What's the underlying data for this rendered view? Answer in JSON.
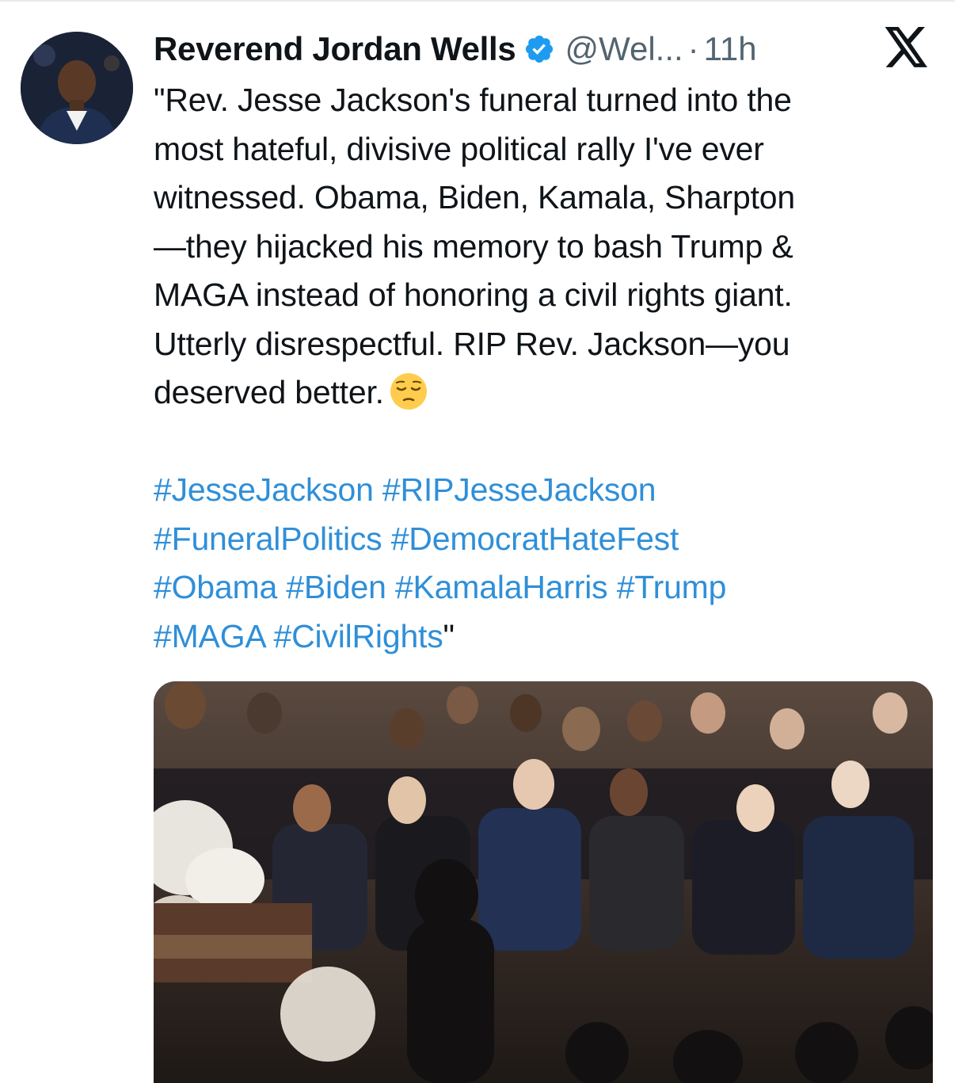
{
  "tweet": {
    "author": {
      "display_name": "Reverend Jordan Wells",
      "handle": "@Wel...",
      "separator": "·",
      "time": "11h",
      "verified": true,
      "verified_icon": "verified-badge-icon",
      "avatar_icon": "avatar"
    },
    "platform_icon": "x-logo-icon",
    "text_lines": [
      "\"Rev. Jesse Jackson's funeral turned into the",
      "most hateful, divisive political rally I've ever",
      "witnessed. Obama, Biden, Kamala, Sharpton",
      "—they hijacked his memory to bash Trump &",
      "MAGA instead of honoring a civil rights giant.",
      "Utterly disrespectful. RIP Rev. Jackson—you",
      "deserved better."
    ],
    "emoji": "pensive-face-emoji",
    "hashtags": {
      "line1": [
        "#JesseJackson",
        "#RIPJesseJackson"
      ],
      "line2": [
        "#FuneralPolitics",
        "#DemocratHateFest"
      ],
      "line3": [
        "#Obama",
        "#Biden",
        "#KamalaHarris",
        "#Trump"
      ],
      "line4": [
        "#MAGA",
        "#CivilRights"
      ],
      "closing_quote": "\""
    },
    "media": {
      "kind": "photo",
      "photo_icon": "attached-photo"
    },
    "colors": {
      "hashtag": "#2f8fd8",
      "verified": "#1d9bf0",
      "secondary_text": "#536471",
      "primary_text": "#0f1419"
    }
  }
}
